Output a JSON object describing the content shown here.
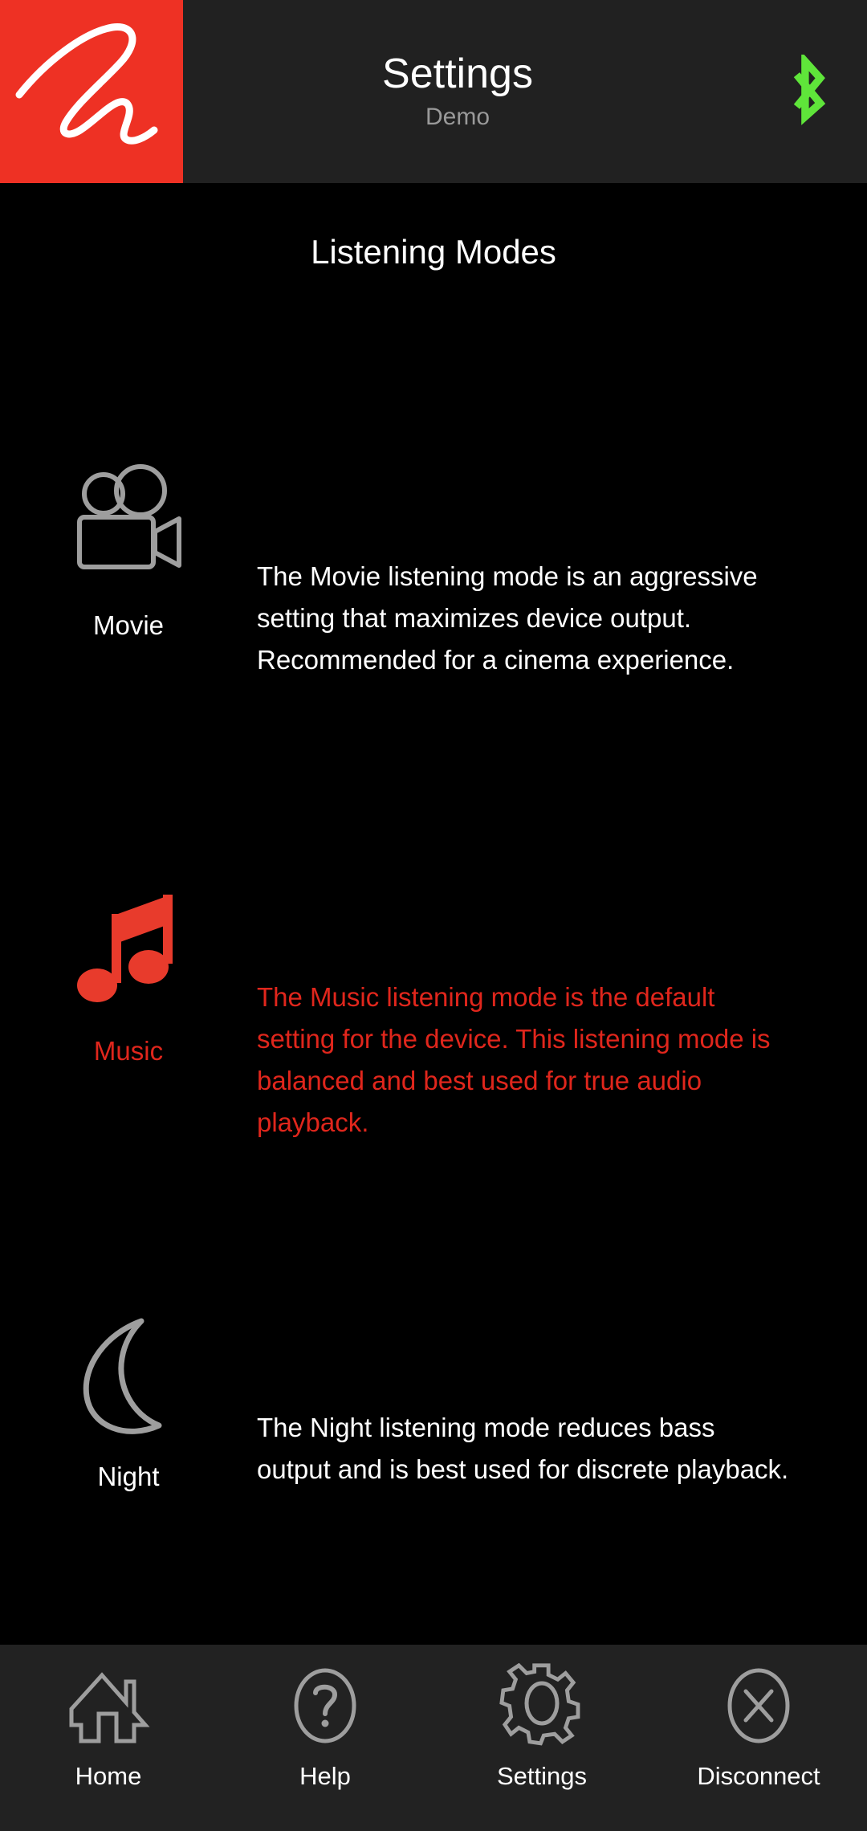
{
  "header": {
    "logo_icon": "brand-script-logo",
    "title": "Settings",
    "subtitle": "Demo",
    "bluetooth_icon": "bluetooth-icon",
    "bluetooth_color": "#5fe53a",
    "brand_color": "#ee3124",
    "background_color": "#212121"
  },
  "main": {
    "heading": "Listening Modes",
    "accent_color": "#e0261c",
    "modes": [
      {
        "id": "movie",
        "label": "Movie",
        "icon": "movie-camera-icon",
        "description": "The Movie listening mode is an aggressive setting that maximizes device output. Recommended for a cinema experience.",
        "selected": false
      },
      {
        "id": "music",
        "label": "Music",
        "icon": "music-note-icon",
        "description": "The Music listening mode is the default setting for the device. This listening mode is balanced and best used for true audio playback.",
        "selected": true
      },
      {
        "id": "night",
        "label": "Night",
        "icon": "crescent-moon-icon",
        "description": "The Night listening mode reduces bass output and is best used for discrete playback.",
        "selected": false
      }
    ]
  },
  "navbar": {
    "background_color": "#222222",
    "items": [
      {
        "id": "home",
        "label": "Home",
        "icon": "home-icon"
      },
      {
        "id": "help",
        "label": "Help",
        "icon": "question-circle-icon"
      },
      {
        "id": "settings",
        "label": "Settings",
        "icon": "gear-icon"
      },
      {
        "id": "disconnect",
        "label": "Disconnect",
        "icon": "close-circle-icon"
      }
    ]
  }
}
